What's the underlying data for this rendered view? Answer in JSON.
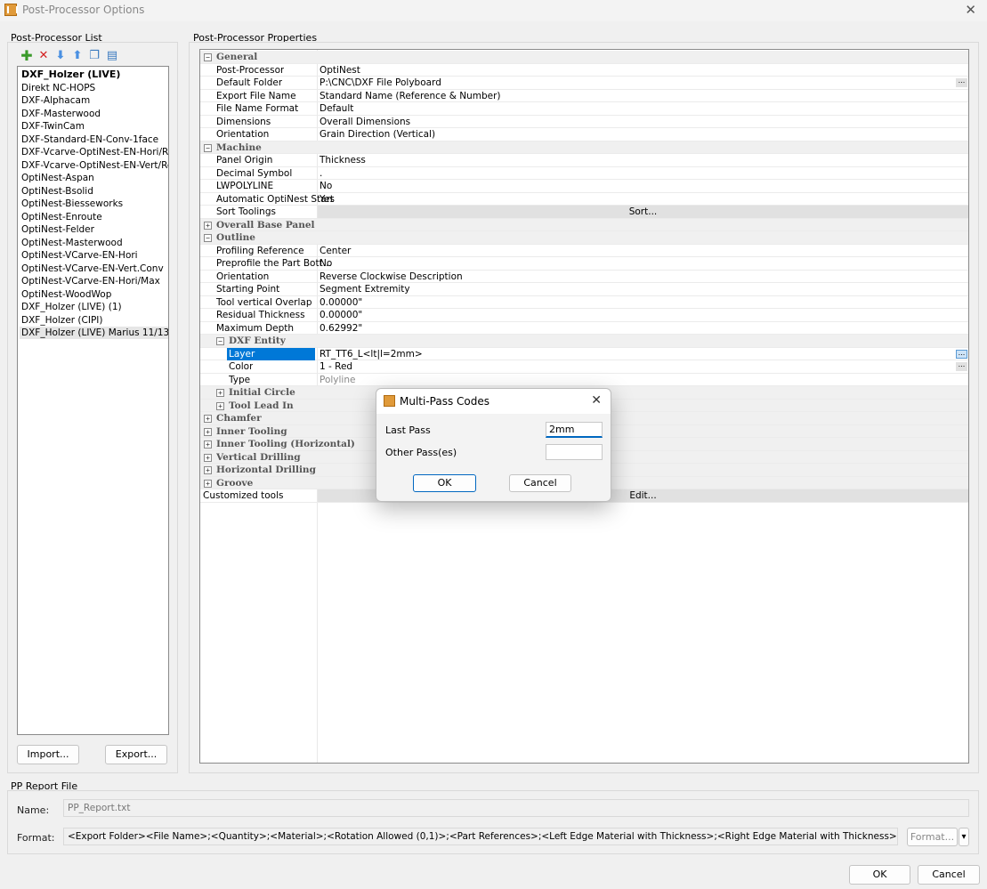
{
  "window": {
    "title": "Post-Processor Options",
    "close": "✕"
  },
  "left": {
    "label": "Post-Processor List",
    "items": [
      "DXF_Holzer (LIVE)",
      "Direkt NC-HOPS",
      "DXF-Alphacam",
      "DXF-Masterwood",
      "DXF-TwinCam",
      "DXF-Standard-EN-Conv-1face",
      "DXF-Vcarve-OptiNest-EN-Hori/Re-...",
      "DXF-Vcarve-OptiNest-EN-Vert/Re-...",
      "OptiNest-Aspan",
      "OptiNest-Bsolid",
      "OptiNest-Biesseworks",
      "OptiNest-Enroute",
      "OptiNest-Felder",
      "OptiNest-Masterwood",
      "OptiNest-VCarve-EN-Hori",
      "OptiNest-VCarve-EN-Vert.Conv",
      "OptiNest-VCarve-EN-Hori/Max",
      "OptiNest-WoodWop",
      "DXF_Holzer (LIVE) (1)",
      "DXF_Holzer (CIPI)",
      "DXF_Holzer (LIVE) Marius 11/13"
    ],
    "import_label": "Import...",
    "export_label": "Export..."
  },
  "props": {
    "label": "Post-Processor Properties",
    "rows": [
      {
        "type": "cat",
        "toggle": "−",
        "name": "General"
      },
      {
        "type": "prop",
        "name": "Post-Processor",
        "value": "OptiNest"
      },
      {
        "type": "prop",
        "name": "Default Folder",
        "value": "P:\\CNC\\DXF File Polyboard",
        "ellipsis": "..."
      },
      {
        "type": "prop",
        "name": "Export File Name",
        "value": "Standard Name (Reference & Number)"
      },
      {
        "type": "prop",
        "name": "File Name Format",
        "value": "Default"
      },
      {
        "type": "prop",
        "name": "Dimensions",
        "value": "Overall Dimensions"
      },
      {
        "type": "prop",
        "name": "Orientation",
        "value": "Grain Direction (Vertical)"
      },
      {
        "type": "cat",
        "toggle": "−",
        "name": "Machine"
      },
      {
        "type": "prop",
        "name": "Panel Origin",
        "value": "Thickness"
      },
      {
        "type": "prop",
        "name": "Decimal Symbol",
        "value": "."
      },
      {
        "type": "prop",
        "name": "LWPOLYLINE",
        "value": "No"
      },
      {
        "type": "prop",
        "name": "Automatic OptiNest Start",
        "value": "Yes"
      },
      {
        "type": "btn",
        "name": "Sort Toolings",
        "value": "Sort..."
      },
      {
        "type": "cat",
        "toggle": "+",
        "name": "Overall Base Panel"
      },
      {
        "type": "cat",
        "toggle": "−",
        "name": "Outline"
      },
      {
        "type": "prop",
        "name": "Profiling Reference",
        "value": "Center"
      },
      {
        "type": "prop",
        "name": "Preprofile the Part Bott...",
        "value": "No"
      },
      {
        "type": "prop",
        "name": "Orientation",
        "value": "Reverse Clockwise Description"
      },
      {
        "type": "prop",
        "name": "Starting Point",
        "value": "Segment Extremity"
      },
      {
        "type": "prop",
        "name": "Tool vertical Overlap",
        "value": "0.00000\""
      },
      {
        "type": "prop",
        "name": "Residual Thickness",
        "value": "0.00000\""
      },
      {
        "type": "prop",
        "name": "Maximum Depth",
        "value": "0.62992\""
      },
      {
        "type": "subcat",
        "toggle": "−",
        "name": "DXF Entity"
      },
      {
        "type": "subprop",
        "sel": true,
        "name": "Layer",
        "value": "RT_TT6_L<lt|l=2mm>",
        "ellipsis": "...",
        "active": true
      },
      {
        "type": "subprop",
        "name": "Color",
        "value": "1 - Red",
        "ellipsis": "..."
      },
      {
        "type": "subprop",
        "name": "Type",
        "value": "Polyline",
        "grey": true
      },
      {
        "type": "subcat",
        "toggle": "+",
        "name": "Initial Circle"
      },
      {
        "type": "subcat",
        "toggle": "+",
        "name": "Tool Lead In"
      },
      {
        "type": "cat",
        "toggle": "+",
        "name": "Chamfer"
      },
      {
        "type": "cat",
        "toggle": "+",
        "name": "Inner Tooling"
      },
      {
        "type": "cat",
        "toggle": "+",
        "name": "Inner Tooling (Horizontal)"
      },
      {
        "type": "cat",
        "toggle": "+",
        "name": "Vertical Drilling"
      },
      {
        "type": "cat",
        "toggle": "+",
        "name": "Horizontal Drilling"
      },
      {
        "type": "cat",
        "toggle": "+",
        "name": "Groove"
      },
      {
        "type": "btn",
        "name": "Customized tools",
        "value": "Edit...",
        "plain": true
      }
    ]
  },
  "report": {
    "label": "PP Report File",
    "name_label": "Name:",
    "name_value": "PP_Report.txt",
    "format_label": "Format:",
    "format_value": "<Export Folder><File Name>;<Quantity>;<Material>;<Rotation Allowed (0,1)>;<Part References>;<Left Edge Material with Thickness>;<Right Edge Material with Thickness>;<Top Edge Material with Thicl",
    "format_button": "Format...",
    "dropdown_arrow": "▾"
  },
  "footer": {
    "ok_label": "OK",
    "cancel_label": "Cancel"
  },
  "dialog": {
    "title": "Multi-Pass Codes",
    "close": "✕",
    "last_pass_label": "Last Pass",
    "last_pass_value": "2mm",
    "other_pass_label": "Other Pass(es)",
    "other_pass_value": "",
    "ok_label": "OK",
    "cancel_label": "Cancel"
  }
}
